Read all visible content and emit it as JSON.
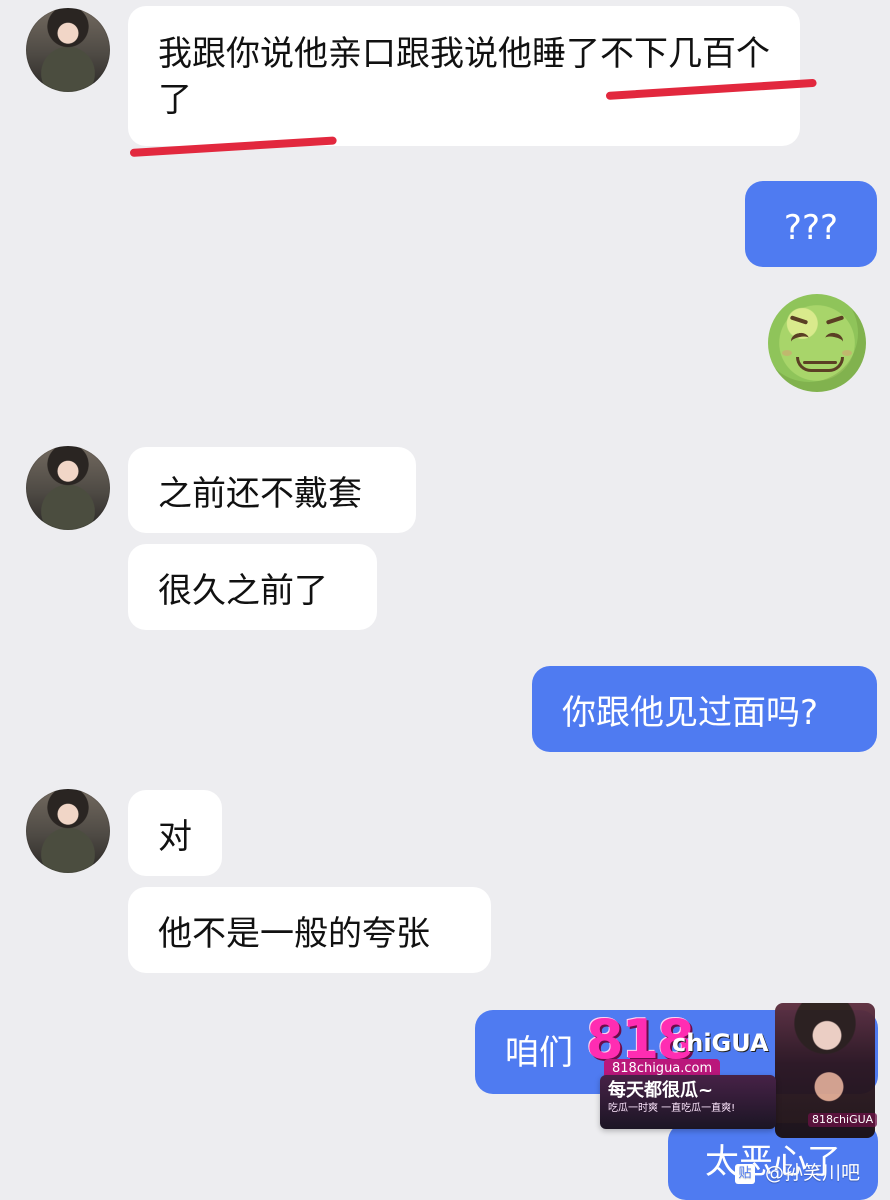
{
  "messages": {
    "m1": "我跟你说他亲口跟我说他睡了不下几百个了",
    "m2": "???",
    "m3": "之前还不戴套",
    "m4": "很久之前了",
    "m5": "你跟他见过面吗?",
    "m6": "对",
    "m7": "他不是一般的夸张",
    "m8": "咱们",
    "m9": "太恶心了"
  },
  "emoji": {
    "name": "nauseated-face"
  },
  "overlay": {
    "logo_big": "818",
    "logo_small": "chiGUA",
    "site": "818chigua.com",
    "headline": "每天都很瓜~",
    "sub": "吃瓜一时爽 一直吃瓜一直爽!",
    "tag": "818chiGUA"
  },
  "watermark": {
    "badge": "贴",
    "text": "@孙笑川吧"
  },
  "colors": {
    "background": "#ededf0",
    "left_bubble": "#ffffff",
    "right_bubble": "#4f7bf1",
    "annotation": "#e2283e"
  }
}
